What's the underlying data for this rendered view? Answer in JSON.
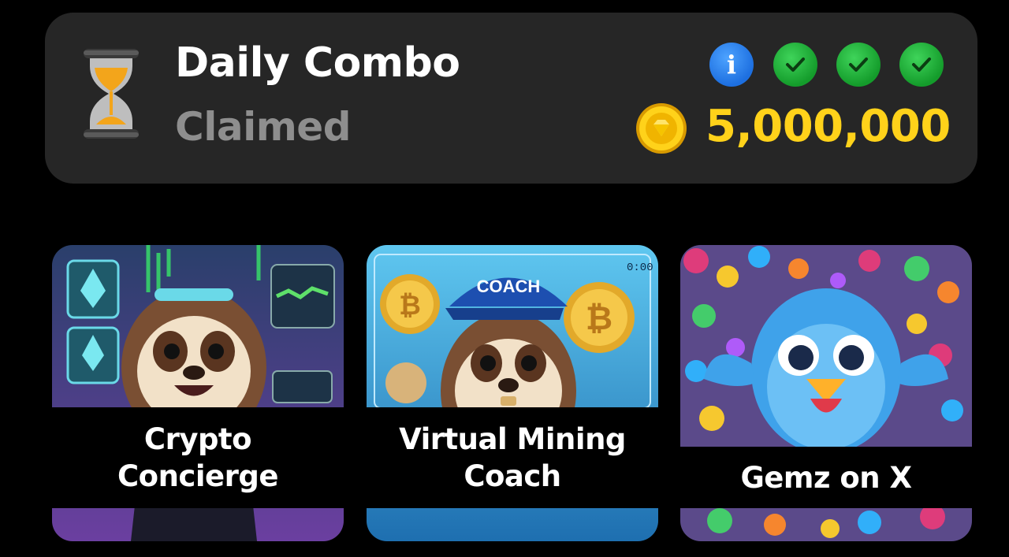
{
  "daily_combo": {
    "title": "Daily Combo",
    "status": "Claimed",
    "icons": [
      "hourglass-icon",
      "info-icon",
      "check-icon",
      "check-icon",
      "check-icon",
      "coin-icon"
    ],
    "info_glyph": "i",
    "reward": "5,000,000",
    "colors": {
      "panel": "#262626",
      "reward": "#ffd21a",
      "status": "#8e8e8e",
      "info": "#1d6fe0",
      "check": "#149c2b"
    }
  },
  "cards": [
    {
      "label": "Crypto\nConcierge"
    },
    {
      "label": "Virtual Mining\nCoach",
      "art_text": "COACH",
      "timer": "0:00"
    },
    {
      "label": "Gemz on X"
    }
  ]
}
